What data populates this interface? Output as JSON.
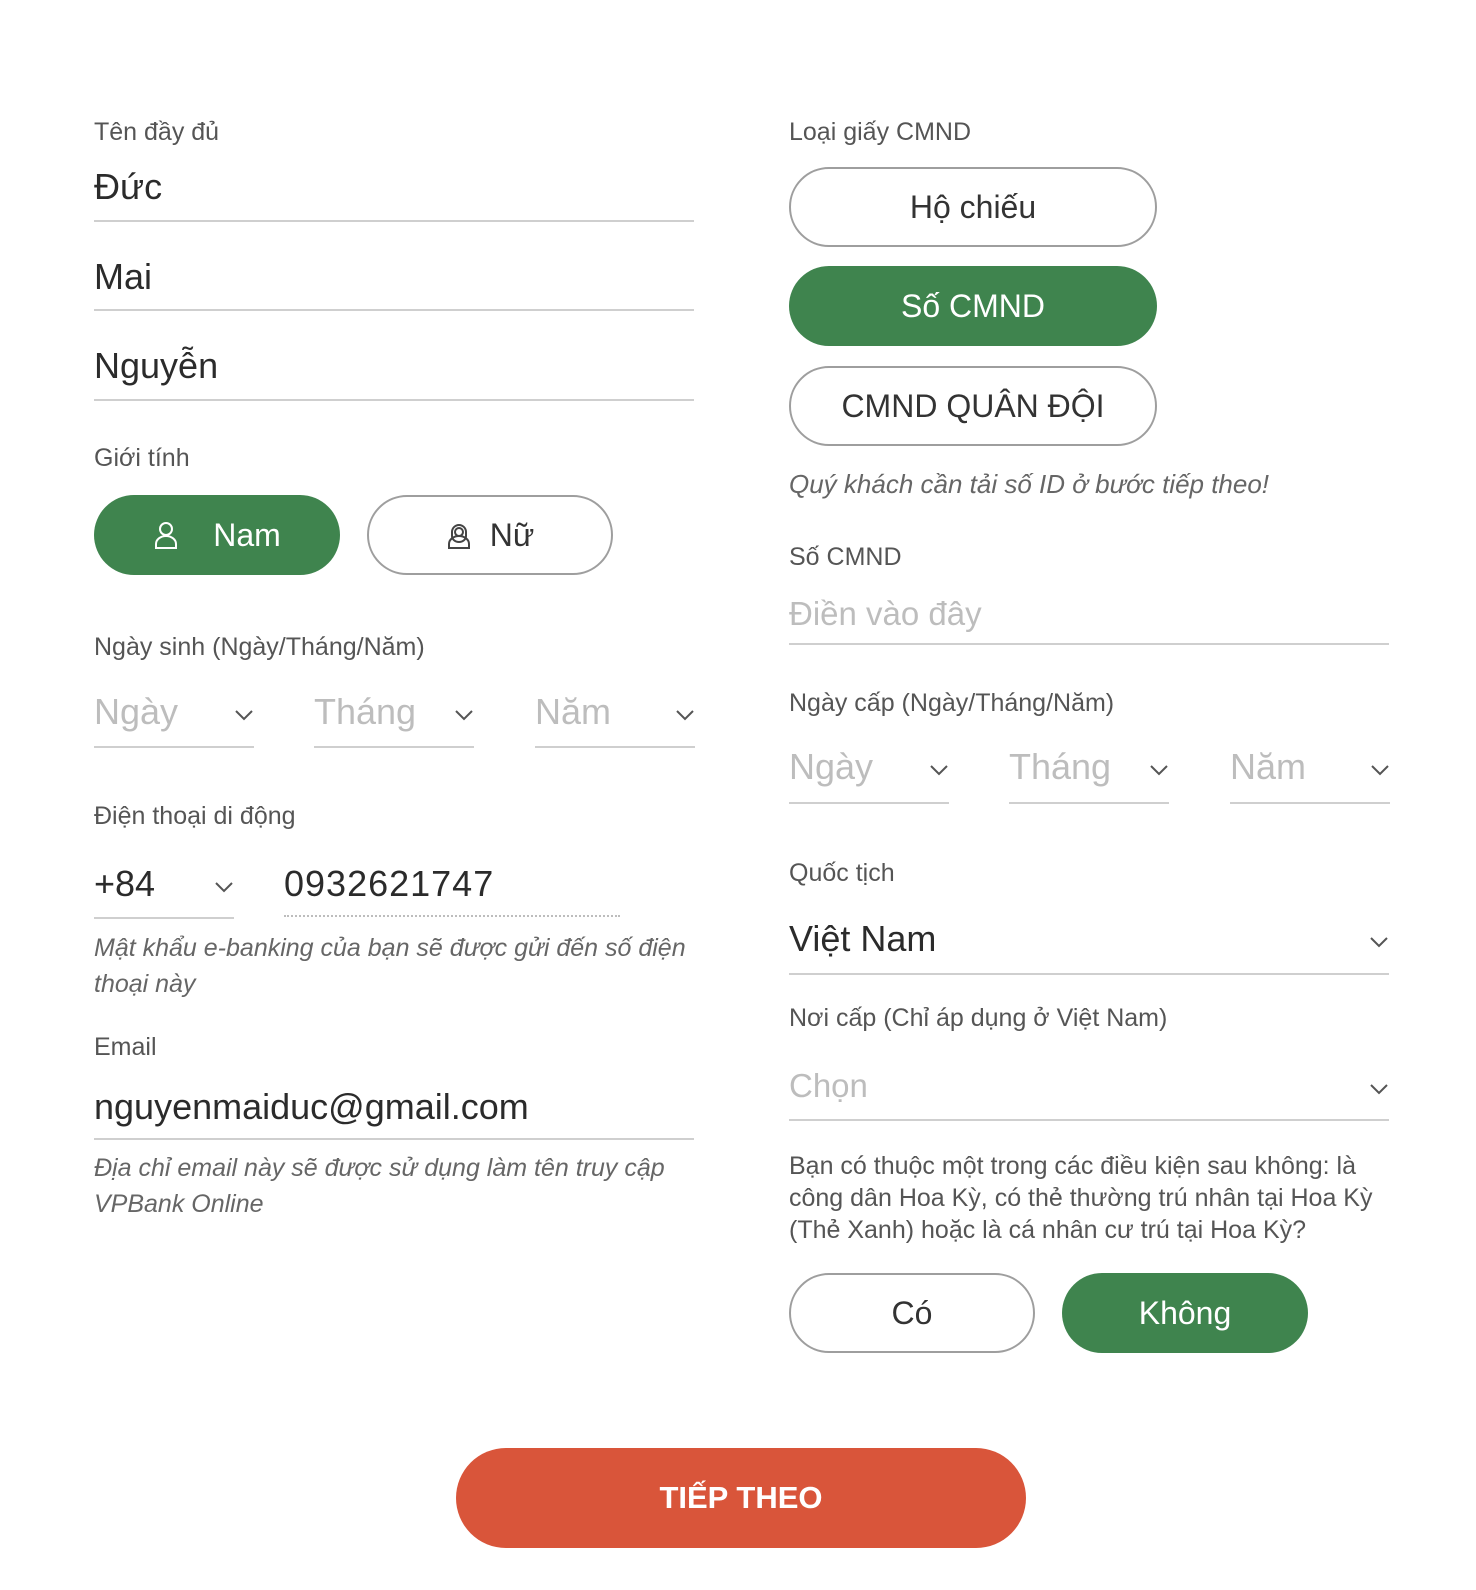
{
  "left": {
    "full_name_label": "Tên đầy đủ",
    "first_name": "Đức",
    "middle_name": "Mai",
    "last_name": "Nguyễn",
    "gender_label": "Giới tính",
    "gender_male": "Nam",
    "gender_female": "Nữ",
    "dob_label": "Ngày sinh (Ngày/Tháng/Năm)",
    "dob_day": "Ngày",
    "dob_month": "Tháng",
    "dob_year": "Năm",
    "phone_label": "Điện thoại di động",
    "phone_code": "+84",
    "phone_number": "0932621747",
    "phone_hint": "Mật khẩu e-banking của bạn sẽ được gửi đến số điện thoại này",
    "email_label": "Email",
    "email_value": "nguyenmaiduc@gmail.com",
    "email_hint": "Địa chỉ email này sẽ được sử dụng làm tên truy cập VPBank Online"
  },
  "right": {
    "id_type_label": "Loại giấy CMND",
    "id_type_passport": "Hộ chiếu",
    "id_type_cmnd": "Số CMND",
    "id_type_military": "CMND QUÂN ĐỘI",
    "id_note": "Quý khách cần tải số ID ở bước tiếp theo!",
    "id_number_label": "Số CMND",
    "id_number_placeholder": "Điền vào đây",
    "issue_date_label": "Ngày cấp (Ngày/Tháng/Năm)",
    "issue_day": "Ngày",
    "issue_month": "Tháng",
    "issue_year": "Năm",
    "nationality_label": "Quốc tịch",
    "nationality_value": "Việt Nam",
    "issue_place_label": "Nơi cấp (Chỉ áp dụng ở Việt Nam)",
    "issue_place_placeholder": "Chọn",
    "us_question": "Bạn có thuộc một trong các điều kiện sau không: là công dân Hoa Kỳ, có thẻ thường trú nhân tại Hoa Kỳ (Thẻ Xanh) hoặc là cá nhân cư trú tại Hoa Kỳ?",
    "us_yes": "Có",
    "us_no": "Không"
  },
  "actions": {
    "next_label": "TIẾP THEO"
  },
  "colors": {
    "primary_green": "#3f844e",
    "cta_orange": "#d9553a"
  },
  "icons": {
    "gender_male": "person-icon",
    "gender_female": "person-female-icon",
    "dropdown": "chevron-down-icon"
  }
}
